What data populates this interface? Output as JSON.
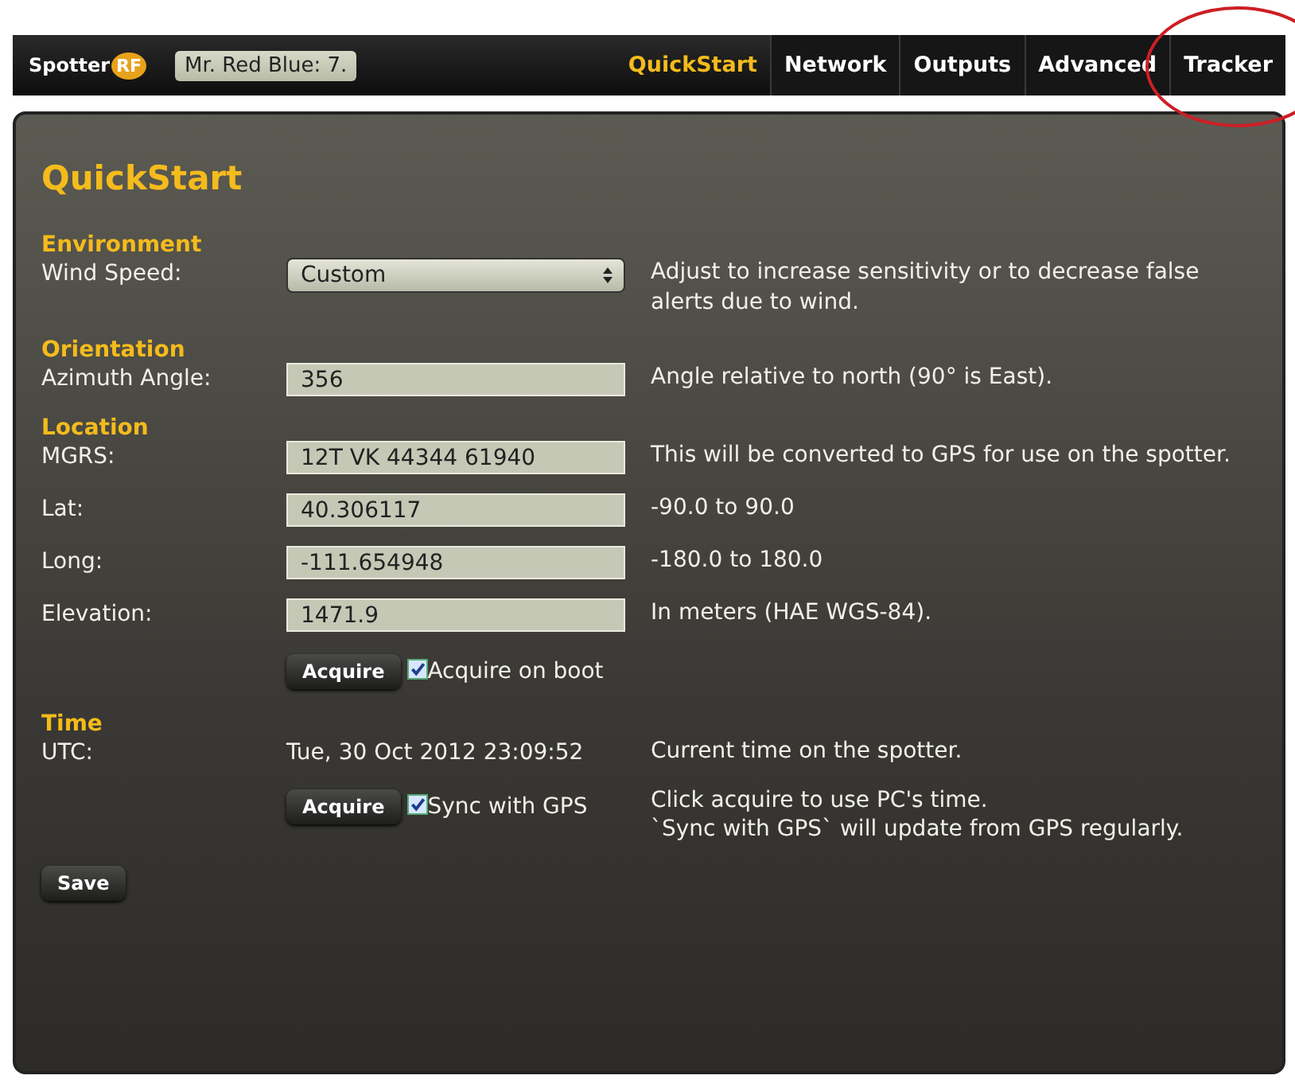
{
  "header": {
    "logo": {
      "main": "Spotter",
      "badge": "RF"
    },
    "device_name": "Mr. Red Blue: 7.",
    "tabs": [
      {
        "label": "QuickStart",
        "selected": true
      },
      {
        "label": "Network",
        "selected": false
      },
      {
        "label": "Outputs",
        "selected": false
      },
      {
        "label": "Advanced",
        "selected": false
      },
      {
        "label": "Tracker",
        "selected": false
      }
    ]
  },
  "page_title": "QuickStart",
  "sections": [
    {
      "heading": "Environment",
      "rows": [
        {
          "kind": "select",
          "label": "Wind Speed:",
          "value": "Custom",
          "help": "Adjust to increase sensitivity or to decrease false alerts due to wind."
        }
      ]
    },
    {
      "heading": "Orientation",
      "rows": [
        {
          "kind": "input",
          "label": "Azimuth Angle:",
          "value": "356",
          "help": "Angle relative to north (90° is East)."
        }
      ]
    },
    {
      "heading": "Location",
      "rows": [
        {
          "kind": "input",
          "label": "MGRS:",
          "value": "12T VK 44344 61940",
          "help": "This will be converted to GPS for use on the spotter."
        },
        {
          "kind": "input",
          "label": "Lat:",
          "value": "40.306117",
          "help": "-90.0 to 90.0"
        },
        {
          "kind": "input",
          "label": "Long:",
          "value": "-111.654948",
          "help": "-180.0 to 180.0"
        },
        {
          "kind": "input",
          "label": "Elevation:",
          "value": "1471.9",
          "help": "In meters (HAE WGS-84)."
        },
        {
          "kind": "acquire",
          "button": "Acquire",
          "checkbox_label": "Acquire on boot",
          "checked": true
        }
      ]
    },
    {
      "heading": "Time",
      "rows": [
        {
          "kind": "text",
          "label": "UTC:",
          "value": "Tue, 30 Oct 2012 23:09:52",
          "help": "Current time on the spotter."
        },
        {
          "kind": "acquire",
          "button": "Acquire",
          "checkbox_label": "Sync with GPS",
          "checked": true,
          "help_lines": [
            "Click acquire to use PC's time.",
            "`Sync with GPS` will update from GPS regularly."
          ]
        }
      ]
    }
  ],
  "save_button": "Save"
}
